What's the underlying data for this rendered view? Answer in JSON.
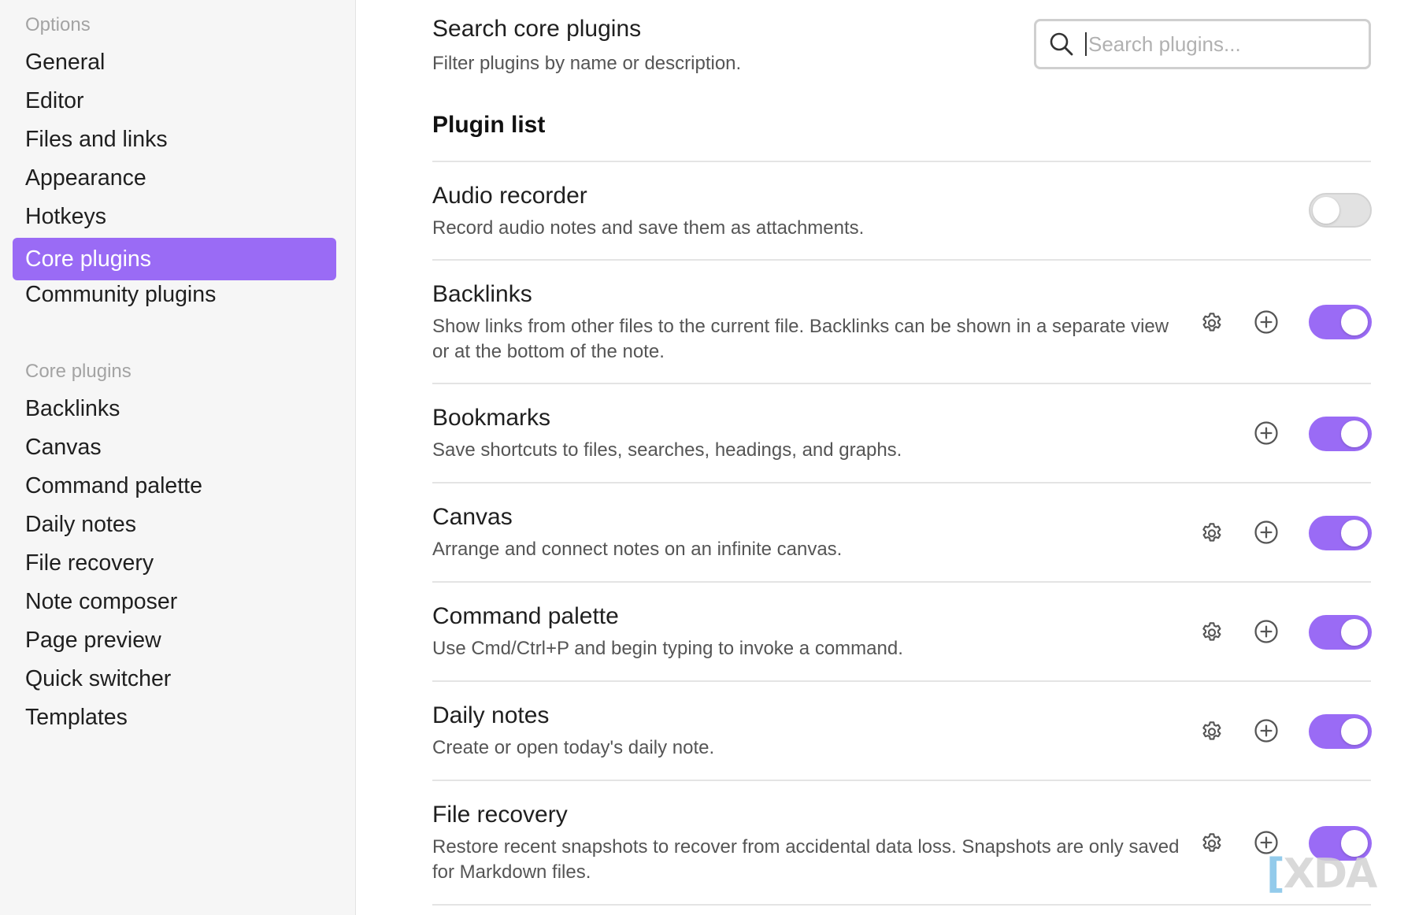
{
  "sidebar": {
    "options_heading": "Options",
    "options_items": [
      {
        "label": "General"
      },
      {
        "label": "Editor"
      },
      {
        "label": "Files and links"
      },
      {
        "label": "Appearance"
      },
      {
        "label": "Hotkeys"
      },
      {
        "label": "Core plugins",
        "active": true
      },
      {
        "label": "Community plugins"
      }
    ],
    "core_heading": "Core plugins",
    "core_items": [
      {
        "label": "Backlinks"
      },
      {
        "label": "Canvas"
      },
      {
        "label": "Command palette"
      },
      {
        "label": "Daily notes"
      },
      {
        "label": "File recovery"
      },
      {
        "label": "Note composer"
      },
      {
        "label": "Page preview"
      },
      {
        "label": "Quick switcher"
      },
      {
        "label": "Templates"
      }
    ]
  },
  "search": {
    "title": "Search core plugins",
    "description": "Filter plugins by name or description.",
    "placeholder": "Search plugins...",
    "value": "",
    "icon": "search-icon"
  },
  "plugin_list": {
    "title": "Plugin list",
    "plugins": [
      {
        "name": "Audio recorder",
        "description": "Record audio notes and save them as attachments.",
        "settings": false,
        "hotkey": false,
        "enabled": false
      },
      {
        "name": "Backlinks",
        "description": "Show links from other files to the current file. Backlinks can be shown in a separate view or at the bottom of the note.",
        "settings": true,
        "hotkey": true,
        "enabled": true
      },
      {
        "name": "Bookmarks",
        "description": "Save shortcuts to files, searches, headings, and graphs.",
        "settings": false,
        "hotkey": true,
        "enabled": true
      },
      {
        "name": "Canvas",
        "description": "Arrange and connect notes on an infinite canvas.",
        "settings": true,
        "hotkey": true,
        "enabled": true
      },
      {
        "name": "Command palette",
        "description": "Use Cmd/Ctrl+P and begin typing to invoke a command.",
        "settings": true,
        "hotkey": true,
        "enabled": true
      },
      {
        "name": "Daily notes",
        "description": "Create or open today's daily note.",
        "settings": true,
        "hotkey": true,
        "enabled": true
      },
      {
        "name": "File recovery",
        "description": "Restore recent snapshots to recover from accidental data loss. Snapshots are only saved for Markdown files.",
        "settings": true,
        "hotkey": true,
        "enabled": true
      }
    ]
  },
  "watermark": {
    "text": "XDA"
  },
  "colors": {
    "accent": "#9a6bf5",
    "sidebar_bg": "#f6f6f6",
    "toggle_off": "#e2e2e2"
  },
  "icons": {
    "settings": "gear-icon",
    "hotkey": "plus-circle-icon"
  }
}
